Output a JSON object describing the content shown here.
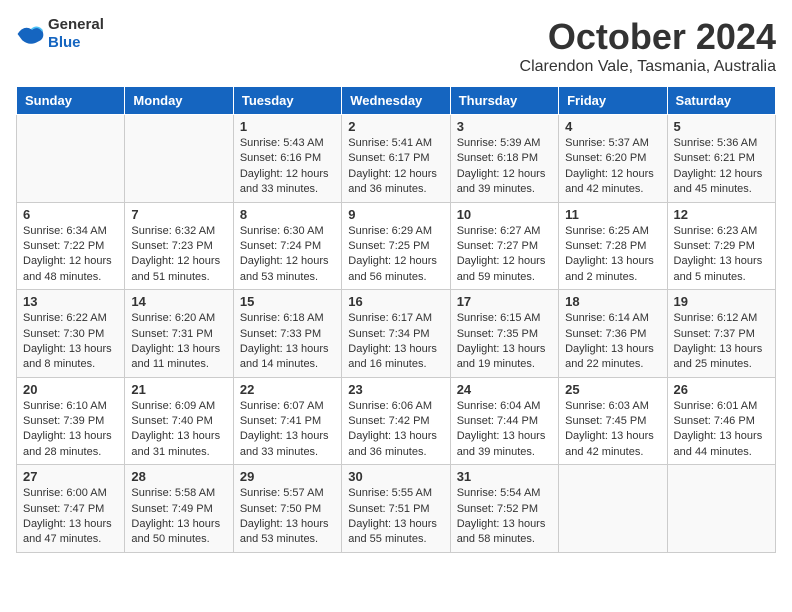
{
  "header": {
    "logo": {
      "general": "General",
      "blue": "Blue"
    },
    "title": "October 2024",
    "subtitle": "Clarendon Vale, Tasmania, Australia"
  },
  "weekdays": [
    "Sunday",
    "Monday",
    "Tuesday",
    "Wednesday",
    "Thursday",
    "Friday",
    "Saturday"
  ],
  "weeks": [
    [
      null,
      null,
      {
        "day": 1,
        "sunrise": "5:43 AM",
        "sunset": "6:16 PM",
        "daylight": "12 hours and 33 minutes."
      },
      {
        "day": 2,
        "sunrise": "5:41 AM",
        "sunset": "6:17 PM",
        "daylight": "12 hours and 36 minutes."
      },
      {
        "day": 3,
        "sunrise": "5:39 AM",
        "sunset": "6:18 PM",
        "daylight": "12 hours and 39 minutes."
      },
      {
        "day": 4,
        "sunrise": "5:37 AM",
        "sunset": "6:20 PM",
        "daylight": "12 hours and 42 minutes."
      },
      {
        "day": 5,
        "sunrise": "5:36 AM",
        "sunset": "6:21 PM",
        "daylight": "12 hours and 45 minutes."
      }
    ],
    [
      {
        "day": 6,
        "sunrise": "6:34 AM",
        "sunset": "7:22 PM",
        "daylight": "12 hours and 48 minutes."
      },
      {
        "day": 7,
        "sunrise": "6:32 AM",
        "sunset": "7:23 PM",
        "daylight": "12 hours and 51 minutes."
      },
      {
        "day": 8,
        "sunrise": "6:30 AM",
        "sunset": "7:24 PM",
        "daylight": "12 hours and 53 minutes."
      },
      {
        "day": 9,
        "sunrise": "6:29 AM",
        "sunset": "7:25 PM",
        "daylight": "12 hours and 56 minutes."
      },
      {
        "day": 10,
        "sunrise": "6:27 AM",
        "sunset": "7:27 PM",
        "daylight": "12 hours and 59 minutes."
      },
      {
        "day": 11,
        "sunrise": "6:25 AM",
        "sunset": "7:28 PM",
        "daylight": "13 hours and 2 minutes."
      },
      {
        "day": 12,
        "sunrise": "6:23 AM",
        "sunset": "7:29 PM",
        "daylight": "13 hours and 5 minutes."
      }
    ],
    [
      {
        "day": 13,
        "sunrise": "6:22 AM",
        "sunset": "7:30 PM",
        "daylight": "13 hours and 8 minutes."
      },
      {
        "day": 14,
        "sunrise": "6:20 AM",
        "sunset": "7:31 PM",
        "daylight": "13 hours and 11 minutes."
      },
      {
        "day": 15,
        "sunrise": "6:18 AM",
        "sunset": "7:33 PM",
        "daylight": "13 hours and 14 minutes."
      },
      {
        "day": 16,
        "sunrise": "6:17 AM",
        "sunset": "7:34 PM",
        "daylight": "13 hours and 16 minutes."
      },
      {
        "day": 17,
        "sunrise": "6:15 AM",
        "sunset": "7:35 PM",
        "daylight": "13 hours and 19 minutes."
      },
      {
        "day": 18,
        "sunrise": "6:14 AM",
        "sunset": "7:36 PM",
        "daylight": "13 hours and 22 minutes."
      },
      {
        "day": 19,
        "sunrise": "6:12 AM",
        "sunset": "7:37 PM",
        "daylight": "13 hours and 25 minutes."
      }
    ],
    [
      {
        "day": 20,
        "sunrise": "6:10 AM",
        "sunset": "7:39 PM",
        "daylight": "13 hours and 28 minutes."
      },
      {
        "day": 21,
        "sunrise": "6:09 AM",
        "sunset": "7:40 PM",
        "daylight": "13 hours and 31 minutes."
      },
      {
        "day": 22,
        "sunrise": "6:07 AM",
        "sunset": "7:41 PM",
        "daylight": "13 hours and 33 minutes."
      },
      {
        "day": 23,
        "sunrise": "6:06 AM",
        "sunset": "7:42 PM",
        "daylight": "13 hours and 36 minutes."
      },
      {
        "day": 24,
        "sunrise": "6:04 AM",
        "sunset": "7:44 PM",
        "daylight": "13 hours and 39 minutes."
      },
      {
        "day": 25,
        "sunrise": "6:03 AM",
        "sunset": "7:45 PM",
        "daylight": "13 hours and 42 minutes."
      },
      {
        "day": 26,
        "sunrise": "6:01 AM",
        "sunset": "7:46 PM",
        "daylight": "13 hours and 44 minutes."
      }
    ],
    [
      {
        "day": 27,
        "sunrise": "6:00 AM",
        "sunset": "7:47 PM",
        "daylight": "13 hours and 47 minutes."
      },
      {
        "day": 28,
        "sunrise": "5:58 AM",
        "sunset": "7:49 PM",
        "daylight": "13 hours and 50 minutes."
      },
      {
        "day": 29,
        "sunrise": "5:57 AM",
        "sunset": "7:50 PM",
        "daylight": "13 hours and 53 minutes."
      },
      {
        "day": 30,
        "sunrise": "5:55 AM",
        "sunset": "7:51 PM",
        "daylight": "13 hours and 55 minutes."
      },
      {
        "day": 31,
        "sunrise": "5:54 AM",
        "sunset": "7:52 PM",
        "daylight": "13 hours and 58 minutes."
      },
      null,
      null
    ]
  ]
}
